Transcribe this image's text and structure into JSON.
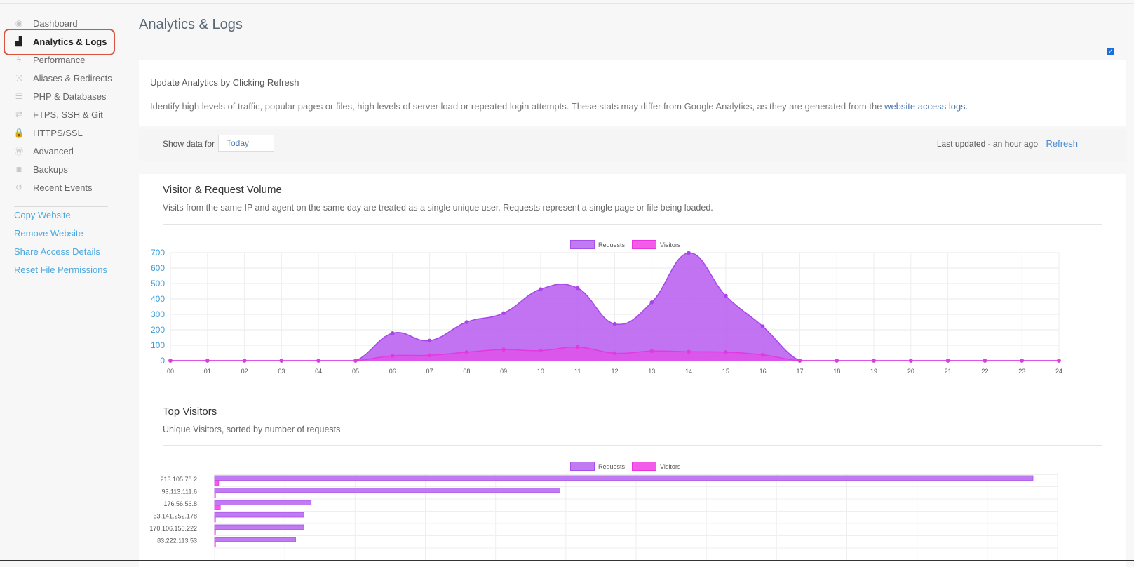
{
  "sidebar": {
    "nav": [
      {
        "label": "Dashboard",
        "icon": "gauge-icon",
        "glyph": "◉"
      },
      {
        "label": "Analytics & Logs",
        "icon": "area-chart-icon",
        "glyph": "▟",
        "active": true
      },
      {
        "label": "Performance",
        "icon": "bolt-icon",
        "glyph": "ϟ"
      },
      {
        "label": "Aliases & Redirects",
        "icon": "shuffle-icon",
        "glyph": "⤨"
      },
      {
        "label": "PHP & Databases",
        "icon": "database-icon",
        "glyph": "☰"
      },
      {
        "label": "FTPS, SSH & Git",
        "icon": "exchange-icon",
        "glyph": "⇄"
      },
      {
        "label": "HTTPS/SSL",
        "icon": "lock-icon",
        "glyph": "🔒"
      },
      {
        "label": "Advanced",
        "icon": "wordpress-icon",
        "glyph": "Ⓦ"
      },
      {
        "label": "Backups",
        "icon": "camera-icon",
        "glyph": "◙"
      },
      {
        "label": "Recent Events",
        "icon": "history-icon",
        "glyph": "↺"
      }
    ],
    "links": [
      "Copy Website",
      "Remove Website",
      "Share Access Details",
      "Reset File Permissions"
    ]
  },
  "page": {
    "title": "Analytics & Logs"
  },
  "info": {
    "title": "Update Analytics by Clicking Refresh",
    "desc": "Identify high levels of traffic, popular pages or files, high levels of server load or repeated login attempts. These stats may differ from Google Analytics, as they are generated from the ",
    "link": "website access logs",
    "desc_end": "."
  },
  "filter": {
    "label": "Show data for",
    "value": "Today",
    "last_updated": "Last updated - an hour ago",
    "refresh": "Refresh"
  },
  "volume": {
    "title": "Visitor & Request Volume",
    "desc": "Visits from the same IP and agent on the same day are treated as a single unique user. Requests represent a single page or file being loaded."
  },
  "top_visitors": {
    "title": "Top Visitors",
    "desc": "Unique Visitors, sorted by number of requests"
  },
  "colors": {
    "requests": "#b65bf0",
    "visitors": "#f047e6",
    "accent": "#4aa8e0",
    "active_ring": "#d9533f"
  },
  "chart_data": [
    {
      "type": "area",
      "legend": [
        "Requests",
        "Visitors"
      ],
      "legend_position": "top",
      "x": [
        "00",
        "01",
        "02",
        "03",
        "04",
        "05",
        "06",
        "07",
        "08",
        "09",
        "10",
        "11",
        "12",
        "13",
        "14",
        "15",
        "16",
        "17",
        "18",
        "19",
        "20",
        "21",
        "22",
        "23",
        "24"
      ],
      "series": [
        {
          "name": "Requests",
          "values": [
            0,
            0,
            0,
            0,
            0,
            0,
            178,
            130,
            250,
            308,
            463,
            470,
            238,
            378,
            698,
            420,
            222,
            0,
            0,
            0,
            0,
            0,
            0,
            0,
            0
          ]
        },
        {
          "name": "Visitors",
          "values": [
            0,
            0,
            0,
            0,
            0,
            0,
            32,
            35,
            55,
            72,
            65,
            88,
            48,
            62,
            58,
            55,
            38,
            0,
            0,
            0,
            0,
            0,
            0,
            0,
            0
          ]
        }
      ],
      "yticks": [
        0,
        100,
        200,
        300,
        400,
        500,
        600,
        700
      ],
      "ylim": [
        0,
        700
      ],
      "grid": true
    },
    {
      "type": "bar",
      "orientation": "horizontal",
      "legend": [
        "Requests",
        "Visitors"
      ],
      "legend_position": "top",
      "categories": [
        "213.105.78.2",
        "93.113.111.6",
        "176.56.56.8",
        "63.141.252.178",
        "170.106.150.222",
        "83.222.113.53"
      ],
      "series": [
        {
          "name": "Requests",
          "values": [
            1000,
            422,
            118,
            109,
            109,
            99
          ]
        },
        {
          "name": "Visitors",
          "values": [
            5,
            1,
            7,
            1,
            1,
            1
          ]
        }
      ],
      "xlim": [
        0,
        1030
      ],
      "grid": true
    }
  ]
}
